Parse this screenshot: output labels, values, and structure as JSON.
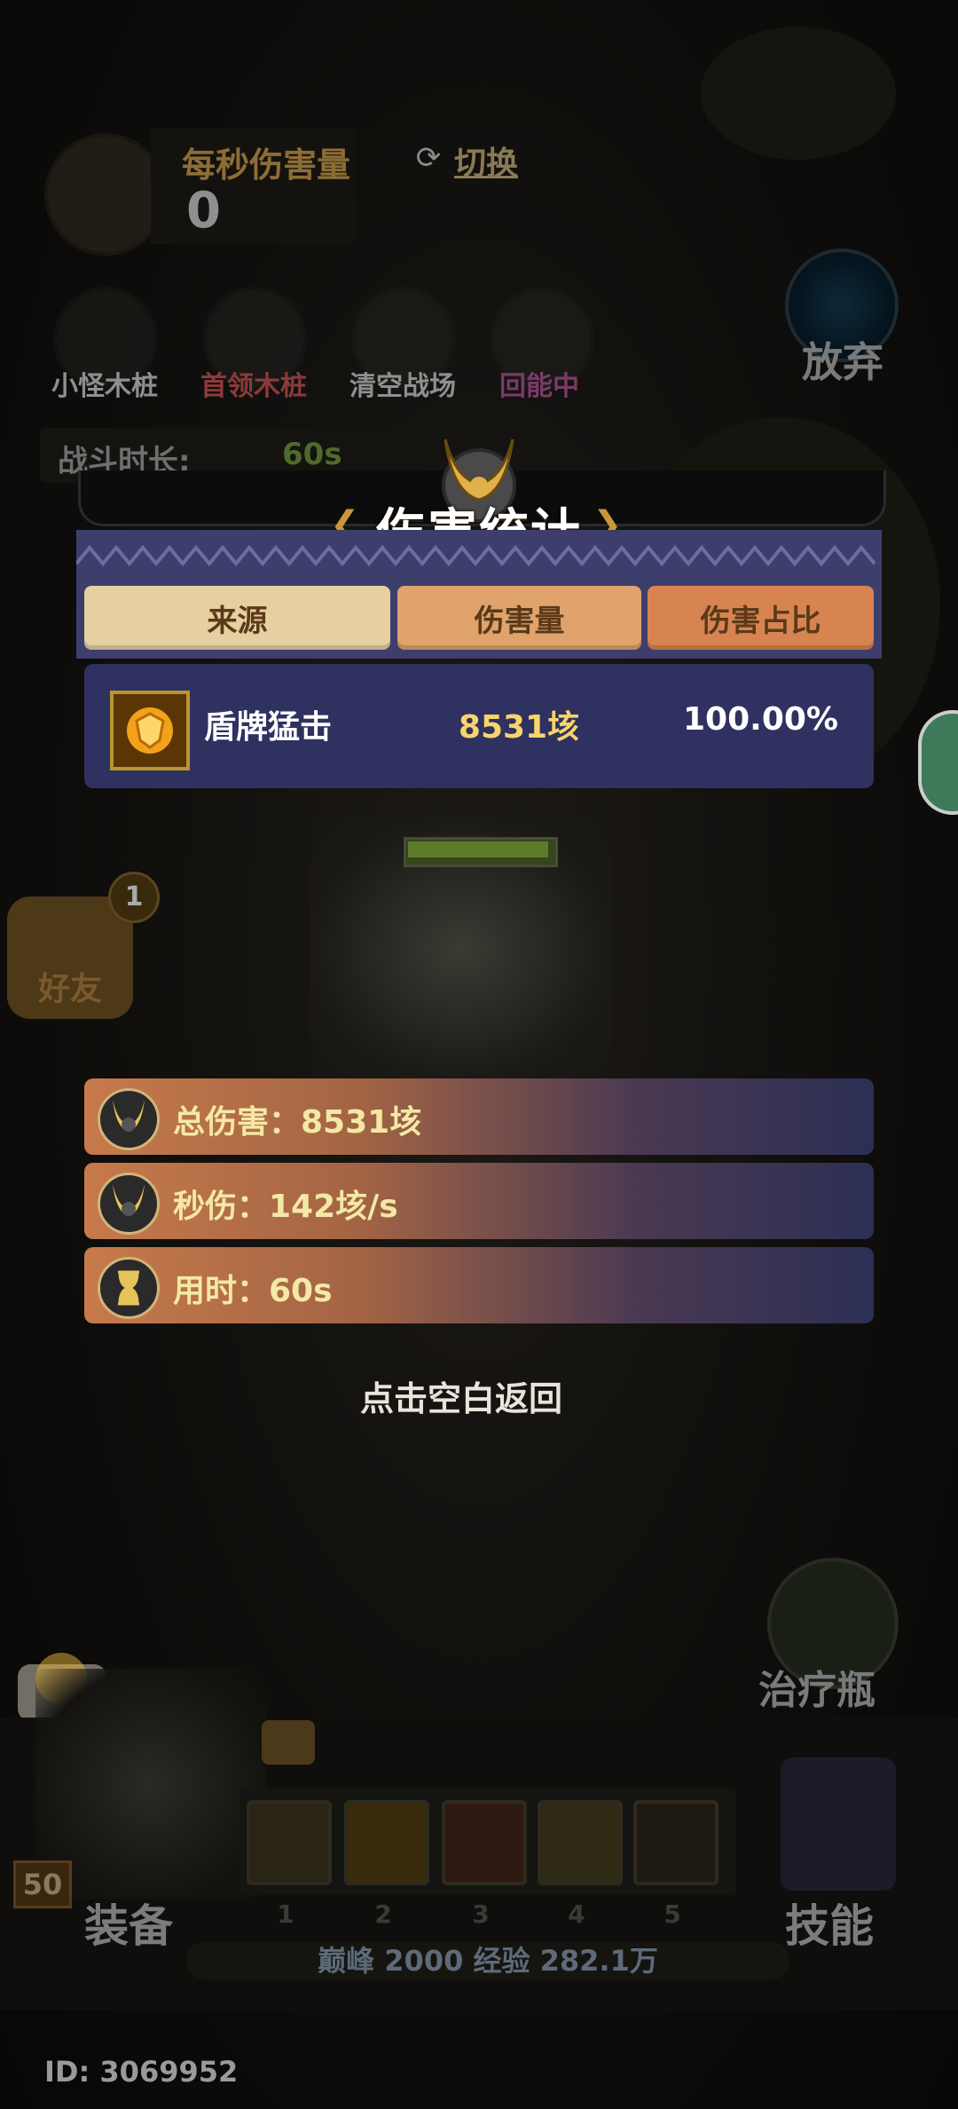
{
  "hud": {
    "dps_label": "每秒伤害量",
    "dps_value": "0",
    "switch_label": "切换"
  },
  "tools": [
    {
      "label": "小怪木桩",
      "color": "#8f8f8f"
    },
    {
      "label": "首领木桩",
      "color": "#8b3a3a"
    },
    {
      "label": "清空战场",
      "color": "#8f8f8f"
    },
    {
      "label": "回能中",
      "color": "#7a3a6a"
    }
  ],
  "giveup_label": "放弃",
  "battle": {
    "duration_label": "战斗时长:",
    "duration_value": "60s"
  },
  "modal": {
    "title": "伤害统计",
    "tabs": [
      {
        "label": "来源",
        "color": "#e6cfa1"
      },
      {
        "label": "伤害量",
        "color": "#e0a36c"
      },
      {
        "label": "伤害占比",
        "color": "#d88451"
      }
    ],
    "rows": [
      {
        "icon": "shield-bash-icon",
        "name": "盾牌猛击",
        "damage": "8531垓",
        "percent": "100.00%"
      }
    ]
  },
  "friend": {
    "label": "好友",
    "badge": "1"
  },
  "stats": [
    {
      "icon": "helmet-icon",
      "text": "总伤害：8531垓"
    },
    {
      "icon": "helmet-icon",
      "text": "秒伤：142垓/s"
    },
    {
      "icon": "hourglass-icon",
      "text": "用时：60s"
    }
  ],
  "hint": "点击空白返回",
  "potion_label": "治疗瓶",
  "equip_label": "装备",
  "level": "50",
  "skill_label": "技能",
  "slot_numbers": [
    "1",
    "2",
    "3",
    "4",
    "5"
  ],
  "xp_text": "巅峰 2000   经验 282.1万",
  "footer_id": "ID: 3069952"
}
